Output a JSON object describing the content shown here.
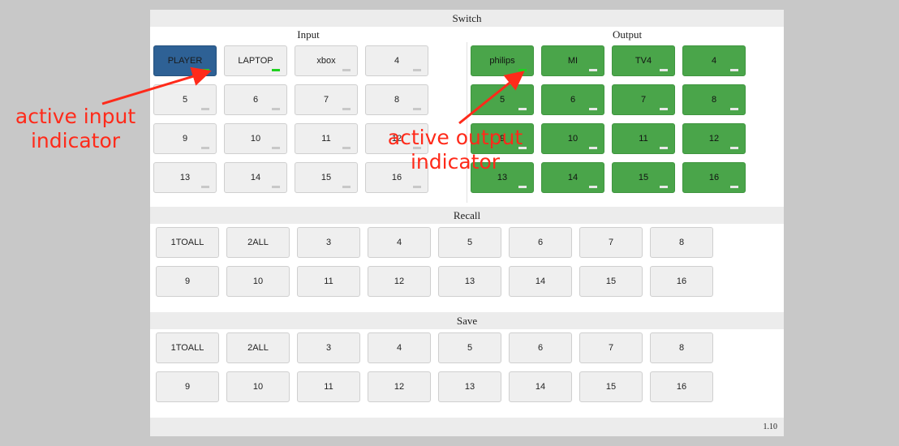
{
  "switch": {
    "title": "Switch",
    "input_title": "Input",
    "output_title": "Output",
    "inputs": [
      {
        "label": "PLAYER",
        "active": true,
        "indicator_on": true
      },
      {
        "label": "LAPTOP",
        "active": false,
        "indicator_on": true
      },
      {
        "label": "xbox",
        "active": false,
        "indicator_on": false
      },
      {
        "label": "4",
        "active": false,
        "indicator_on": false
      },
      {
        "label": "5",
        "active": false,
        "indicator_on": false
      },
      {
        "label": "6",
        "active": false,
        "indicator_on": false
      },
      {
        "label": "7",
        "active": false,
        "indicator_on": false
      },
      {
        "label": "8",
        "active": false,
        "indicator_on": false
      },
      {
        "label": "9",
        "active": false,
        "indicator_on": false
      },
      {
        "label": "10",
        "active": false,
        "indicator_on": false
      },
      {
        "label": "11",
        "active": false,
        "indicator_on": false
      },
      {
        "label": "12",
        "active": false,
        "indicator_on": false
      },
      {
        "label": "13",
        "active": false,
        "indicator_on": false
      },
      {
        "label": "14",
        "active": false,
        "indicator_on": false
      },
      {
        "label": "15",
        "active": false,
        "indicator_on": false
      },
      {
        "label": "16",
        "active": false,
        "indicator_on": false
      }
    ],
    "outputs": [
      {
        "label": "philips",
        "indicator_on": true
      },
      {
        "label": "MI",
        "indicator_on": false
      },
      {
        "label": "TV4",
        "indicator_on": false
      },
      {
        "label": "4",
        "indicator_on": false
      },
      {
        "label": "5",
        "indicator_on": false
      },
      {
        "label": "6",
        "indicator_on": false
      },
      {
        "label": "7",
        "indicator_on": false
      },
      {
        "label": "8",
        "indicator_on": false
      },
      {
        "label": "9",
        "indicator_on": false
      },
      {
        "label": "10",
        "indicator_on": false
      },
      {
        "label": "11",
        "indicator_on": false
      },
      {
        "label": "12",
        "indicator_on": false
      },
      {
        "label": "13",
        "indicator_on": false
      },
      {
        "label": "14",
        "indicator_on": false
      },
      {
        "label": "15",
        "indicator_on": false
      },
      {
        "label": "16",
        "indicator_on": false
      }
    ]
  },
  "recall": {
    "title": "Recall",
    "items": [
      "1TOALL",
      "2ALL",
      "3",
      "4",
      "5",
      "6",
      "7",
      "8",
      "9",
      "10",
      "11",
      "12",
      "13",
      "14",
      "15",
      "16"
    ]
  },
  "save": {
    "title": "Save",
    "items": [
      "1TOALL",
      "2ALL",
      "3",
      "4",
      "5",
      "6",
      "7",
      "8",
      "9",
      "10",
      "11",
      "12",
      "13",
      "14",
      "15",
      "16"
    ]
  },
  "footer": {
    "version": "1.10"
  },
  "annotations": {
    "input_line1": "active input",
    "input_line2": "indicator",
    "output_line1": "active output",
    "output_line2": "indicator"
  },
  "colors": {
    "active_input": "#2e6195",
    "output": "#4aa54a",
    "indicator_on": "#20d020",
    "annotation": "#ff2a1a"
  }
}
